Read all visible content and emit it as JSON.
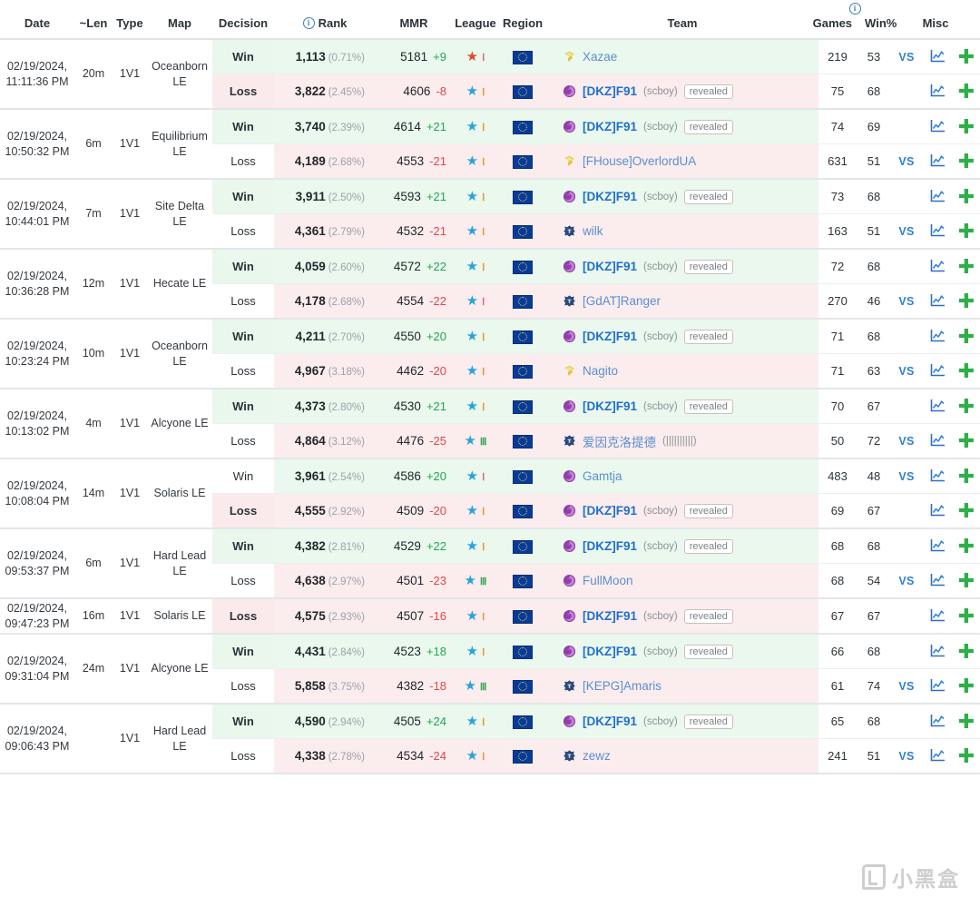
{
  "columns": {
    "date": "Date",
    "len": "~Len",
    "type": "Type",
    "map": "Map",
    "decision": "Decision",
    "rank": "Rank",
    "mmr": "MMR",
    "league": "League",
    "region": "Region",
    "team": "Team",
    "games": "Games",
    "winpct": "Win%",
    "misc": "Misc",
    "rank_info_icon": "info-icon",
    "games_info_icon": "info-icon"
  },
  "colors": {
    "win_tint": "#eaf8ed",
    "loss_tint": "#fbeced",
    "link": "#2e7fd4",
    "mmr_up": "#23a455",
    "mmr_down": "#e0484b",
    "plus": "#2fae4a",
    "star_bronze": "#e0492c",
    "star_diamond": "#29a3dc",
    "tier_red": "#e06a73",
    "tier_orange": "#e8962f",
    "tier_green": "#3aa65a"
  },
  "watermark": {
    "text": "小黑盒"
  },
  "matches": [
    {
      "date": "02/19/2024, 11:11:36 PM",
      "len": "20m",
      "type": "1V1",
      "map": "Oceanborn LE",
      "players": [
        {
          "decision": "Win",
          "highlight": "win",
          "rank": "1,113",
          "pct": "(0.71%)",
          "mmr": "5181",
          "delta": "+9",
          "delta_dir": "up",
          "league_star": "bronze",
          "tier": "Ⅰ",
          "tier_color": "red",
          "region": "eu",
          "race": "protoss",
          "name": "Xazae",
          "alias": "",
          "revealed": false,
          "bold": false,
          "games": "219",
          "winpct": "53",
          "vs": true,
          "tint": "win"
        },
        {
          "decision": "Loss",
          "highlight": "loss",
          "rank": "3,822",
          "pct": "(2.45%)",
          "mmr": "4606",
          "delta": "-8",
          "delta_dir": "down",
          "league_star": "diamond",
          "tier": "Ⅰ",
          "tier_color": "orange",
          "region": "eu",
          "race": "zerg",
          "name": "[DKZ]F91",
          "alias": "(scboy)",
          "revealed": true,
          "bold": true,
          "games": "75",
          "winpct": "68",
          "vs": false,
          "tint": "loss"
        }
      ]
    },
    {
      "date": "02/19/2024, 10:50:32 PM",
      "len": "6m",
      "type": "1V1",
      "map": "Equilibrium LE",
      "players": [
        {
          "decision": "Win",
          "highlight": "win",
          "rank": "3,740",
          "pct": "(2.39%)",
          "mmr": "4614",
          "delta": "+21",
          "delta_dir": "up",
          "league_star": "diamond",
          "tier": "Ⅰ",
          "tier_color": "orange",
          "region": "eu",
          "race": "zerg",
          "name": "[DKZ]F91",
          "alias": "(scboy)",
          "revealed": true,
          "bold": true,
          "games": "74",
          "winpct": "69",
          "vs": false,
          "tint": "win"
        },
        {
          "decision": "Loss",
          "highlight": "none",
          "rank": "4,189",
          "pct": "(2.68%)",
          "mmr": "4553",
          "delta": "-21",
          "delta_dir": "down",
          "league_star": "diamond",
          "tier": "Ⅰ",
          "tier_color": "orange",
          "region": "eu",
          "race": "protoss",
          "name": "[FHouse]OverlordUA",
          "alias": "",
          "revealed": false,
          "bold": false,
          "games": "631",
          "winpct": "51",
          "vs": true,
          "tint": "loss"
        }
      ]
    },
    {
      "date": "02/19/2024, 10:44:01 PM",
      "len": "7m",
      "type": "1V1",
      "map": "Site Delta LE",
      "players": [
        {
          "decision": "Win",
          "highlight": "win",
          "rank": "3,911",
          "pct": "(2.50%)",
          "mmr": "4593",
          "delta": "+21",
          "delta_dir": "up",
          "league_star": "diamond",
          "tier": "Ⅰ",
          "tier_color": "orange",
          "region": "eu",
          "race": "zerg",
          "name": "[DKZ]F91",
          "alias": "(scboy)",
          "revealed": true,
          "bold": true,
          "games": "73",
          "winpct": "68",
          "vs": false,
          "tint": "win"
        },
        {
          "decision": "Loss",
          "highlight": "none",
          "rank": "4,361",
          "pct": "(2.79%)",
          "mmr": "4532",
          "delta": "-21",
          "delta_dir": "down",
          "league_star": "diamond",
          "tier": "Ⅰ",
          "tier_color": "orange",
          "region": "eu",
          "race": "terran",
          "name": "wilk",
          "alias": "",
          "revealed": false,
          "bold": false,
          "games": "163",
          "winpct": "51",
          "vs": true,
          "tint": "loss"
        }
      ]
    },
    {
      "date": "02/19/2024, 10:36:28 PM",
      "len": "12m",
      "type": "1V1",
      "map": "Hecate LE",
      "players": [
        {
          "decision": "Win",
          "highlight": "win",
          "rank": "4,059",
          "pct": "(2.60%)",
          "mmr": "4572",
          "delta": "+22",
          "delta_dir": "up",
          "league_star": "diamond",
          "tier": "Ⅰ",
          "tier_color": "orange",
          "region": "eu",
          "race": "zerg",
          "name": "[DKZ]F91",
          "alias": "(scboy)",
          "revealed": true,
          "bold": true,
          "games": "72",
          "winpct": "68",
          "vs": false,
          "tint": "win"
        },
        {
          "decision": "Loss",
          "highlight": "none",
          "rank": "4,178",
          "pct": "(2.68%)",
          "mmr": "4554",
          "delta": "-22",
          "delta_dir": "down",
          "league_star": "diamond",
          "tier": "Ⅰ",
          "tier_color": "red",
          "region": "eu",
          "race": "terran",
          "name": "[GdAT]Ranger",
          "alias": "",
          "revealed": false,
          "bold": false,
          "games": "270",
          "winpct": "46",
          "vs": true,
          "tint": "loss"
        }
      ]
    },
    {
      "date": "02/19/2024, 10:23:24 PM",
      "len": "10m",
      "type": "1V1",
      "map": "Oceanborn LE",
      "players": [
        {
          "decision": "Win",
          "highlight": "win",
          "rank": "4,211",
          "pct": "(2.70%)",
          "mmr": "4550",
          "delta": "+20",
          "delta_dir": "up",
          "league_star": "diamond",
          "tier": "Ⅰ",
          "tier_color": "orange",
          "region": "eu",
          "race": "zerg",
          "name": "[DKZ]F91",
          "alias": "(scboy)",
          "revealed": true,
          "bold": true,
          "games": "71",
          "winpct": "68",
          "vs": false,
          "tint": "win"
        },
        {
          "decision": "Loss",
          "highlight": "none",
          "rank": "4,967",
          "pct": "(3.18%)",
          "mmr": "4462",
          "delta": "-20",
          "delta_dir": "down",
          "league_star": "diamond",
          "tier": "Ⅰ",
          "tier_color": "orange",
          "region": "eu",
          "race": "protoss",
          "name": "Nagito",
          "alias": "",
          "revealed": false,
          "bold": false,
          "games": "71",
          "winpct": "63",
          "vs": true,
          "tint": "loss"
        }
      ]
    },
    {
      "date": "02/19/2024, 10:13:02 PM",
      "len": "4m",
      "type": "1V1",
      "map": "Alcyone LE",
      "players": [
        {
          "decision": "Win",
          "highlight": "win",
          "rank": "4,373",
          "pct": "(2.80%)",
          "mmr": "4530",
          "delta": "+21",
          "delta_dir": "up",
          "league_star": "diamond",
          "tier": "Ⅰ",
          "tier_color": "orange",
          "region": "eu",
          "race": "zerg",
          "name": "[DKZ]F91",
          "alias": "(scboy)",
          "revealed": true,
          "bold": true,
          "games": "70",
          "winpct": "67",
          "vs": false,
          "tint": "win"
        },
        {
          "decision": "Loss",
          "highlight": "none",
          "rank": "4,864",
          "pct": "(3.12%)",
          "mmr": "4476",
          "delta": "-25",
          "delta_dir": "down",
          "league_star": "diamond",
          "tier": "Ⅲ",
          "tier_color": "green",
          "region": "eu",
          "race": "terran",
          "name": "爱因克洛提德",
          "alias": "(||||||||||)",
          "revealed": false,
          "bold": false,
          "games": "50",
          "winpct": "72",
          "vs": true,
          "tint": "loss"
        }
      ]
    },
    {
      "date": "02/19/2024, 10:08:04 PM",
      "len": "14m",
      "type": "1V1",
      "map": "Solaris LE",
      "players": [
        {
          "decision": "Win",
          "highlight": "none",
          "rank": "3,961",
          "pct": "(2.54%)",
          "mmr": "4586",
          "delta": "+20",
          "delta_dir": "up",
          "league_star": "diamond",
          "tier": "Ⅰ",
          "tier_color": "red",
          "region": "eu",
          "race": "zerg",
          "name": "Gamtja",
          "alias": "",
          "revealed": false,
          "bold": false,
          "games": "483",
          "winpct": "48",
          "vs": true,
          "tint": "win"
        },
        {
          "decision": "Loss",
          "highlight": "loss",
          "rank": "4,555",
          "pct": "(2.92%)",
          "mmr": "4509",
          "delta": "-20",
          "delta_dir": "down",
          "league_star": "diamond",
          "tier": "Ⅰ",
          "tier_color": "orange",
          "region": "eu",
          "race": "zerg",
          "name": "[DKZ]F91",
          "alias": "(scboy)",
          "revealed": true,
          "bold": true,
          "games": "69",
          "winpct": "67",
          "vs": false,
          "tint": "loss"
        }
      ]
    },
    {
      "date": "02/19/2024, 09:53:37 PM",
      "len": "6m",
      "type": "1V1",
      "map": "Hard Lead LE",
      "players": [
        {
          "decision": "Win",
          "highlight": "win",
          "rank": "4,382",
          "pct": "(2.81%)",
          "mmr": "4529",
          "delta": "+22",
          "delta_dir": "up",
          "league_star": "diamond",
          "tier": "Ⅰ",
          "tier_color": "orange",
          "region": "eu",
          "race": "zerg",
          "name": "[DKZ]F91",
          "alias": "(scboy)",
          "revealed": true,
          "bold": true,
          "games": "68",
          "winpct": "68",
          "vs": false,
          "tint": "win"
        },
        {
          "decision": "Loss",
          "highlight": "none",
          "rank": "4,638",
          "pct": "(2.97%)",
          "mmr": "4501",
          "delta": "-23",
          "delta_dir": "down",
          "league_star": "diamond",
          "tier": "Ⅲ",
          "tier_color": "green",
          "region": "eu",
          "race": "zerg",
          "name": "FullMoon",
          "alias": "",
          "revealed": false,
          "bold": false,
          "games": "68",
          "winpct": "54",
          "vs": true,
          "tint": "loss"
        }
      ]
    },
    {
      "date": "02/19/2024, 09:47:23 PM",
      "len": "16m",
      "type": "1V1",
      "map": "Solaris LE",
      "players": [
        {
          "decision": "Loss",
          "highlight": "loss",
          "rank": "4,575",
          "pct": "(2.93%)",
          "mmr": "4507",
          "delta": "-16",
          "delta_dir": "down",
          "league_star": "diamond",
          "tier": "Ⅰ",
          "tier_color": "orange",
          "region": "eu",
          "race": "zerg",
          "name": "[DKZ]F91",
          "alias": "(scboy)",
          "revealed": true,
          "bold": true,
          "games": "67",
          "winpct": "67",
          "vs": false,
          "tint": "loss"
        }
      ]
    },
    {
      "date": "02/19/2024, 09:31:04 PM",
      "len": "24m",
      "type": "1V1",
      "map": "Alcyone LE",
      "players": [
        {
          "decision": "Win",
          "highlight": "win",
          "rank": "4,431",
          "pct": "(2.84%)",
          "mmr": "4523",
          "delta": "+18",
          "delta_dir": "up",
          "league_star": "diamond",
          "tier": "Ⅰ",
          "tier_color": "orange",
          "region": "eu",
          "race": "zerg",
          "name": "[DKZ]F91",
          "alias": "(scboy)",
          "revealed": true,
          "bold": true,
          "games": "66",
          "winpct": "68",
          "vs": false,
          "tint": "win"
        },
        {
          "decision": "Loss",
          "highlight": "none",
          "rank": "5,858",
          "pct": "(3.75%)",
          "mmr": "4382",
          "delta": "-18",
          "delta_dir": "down",
          "league_star": "diamond",
          "tier": "Ⅲ",
          "tier_color": "green",
          "region": "eu",
          "race": "terran",
          "name": "[KEPG]Amaris",
          "alias": "",
          "revealed": false,
          "bold": false,
          "games": "61",
          "winpct": "74",
          "vs": true,
          "tint": "loss"
        }
      ]
    },
    {
      "date": "02/19/2024, 09:06:43 PM",
      "len": "",
      "type": "1V1",
      "map": "Hard Lead LE",
      "players": [
        {
          "decision": "Win",
          "highlight": "win",
          "rank": "4,590",
          "pct": "(2.94%)",
          "mmr": "4505",
          "delta": "+24",
          "delta_dir": "up",
          "league_star": "diamond",
          "tier": "Ⅰ",
          "tier_color": "orange",
          "region": "eu",
          "race": "zerg",
          "name": "[DKZ]F91",
          "alias": "(scboy)",
          "revealed": true,
          "bold": true,
          "games": "65",
          "winpct": "68",
          "vs": false,
          "tint": "win"
        },
        {
          "decision": "Loss",
          "highlight": "none",
          "rank": "4,338",
          "pct": "(2.78%)",
          "mmr": "4534",
          "delta": "-24",
          "delta_dir": "down",
          "league_star": "diamond",
          "tier": "Ⅰ",
          "tier_color": "orange",
          "region": "eu",
          "race": "terran",
          "name": "zewz",
          "alias": "",
          "revealed": false,
          "bold": false,
          "games": "241",
          "winpct": "51",
          "vs": true,
          "tint": "loss"
        }
      ]
    }
  ]
}
